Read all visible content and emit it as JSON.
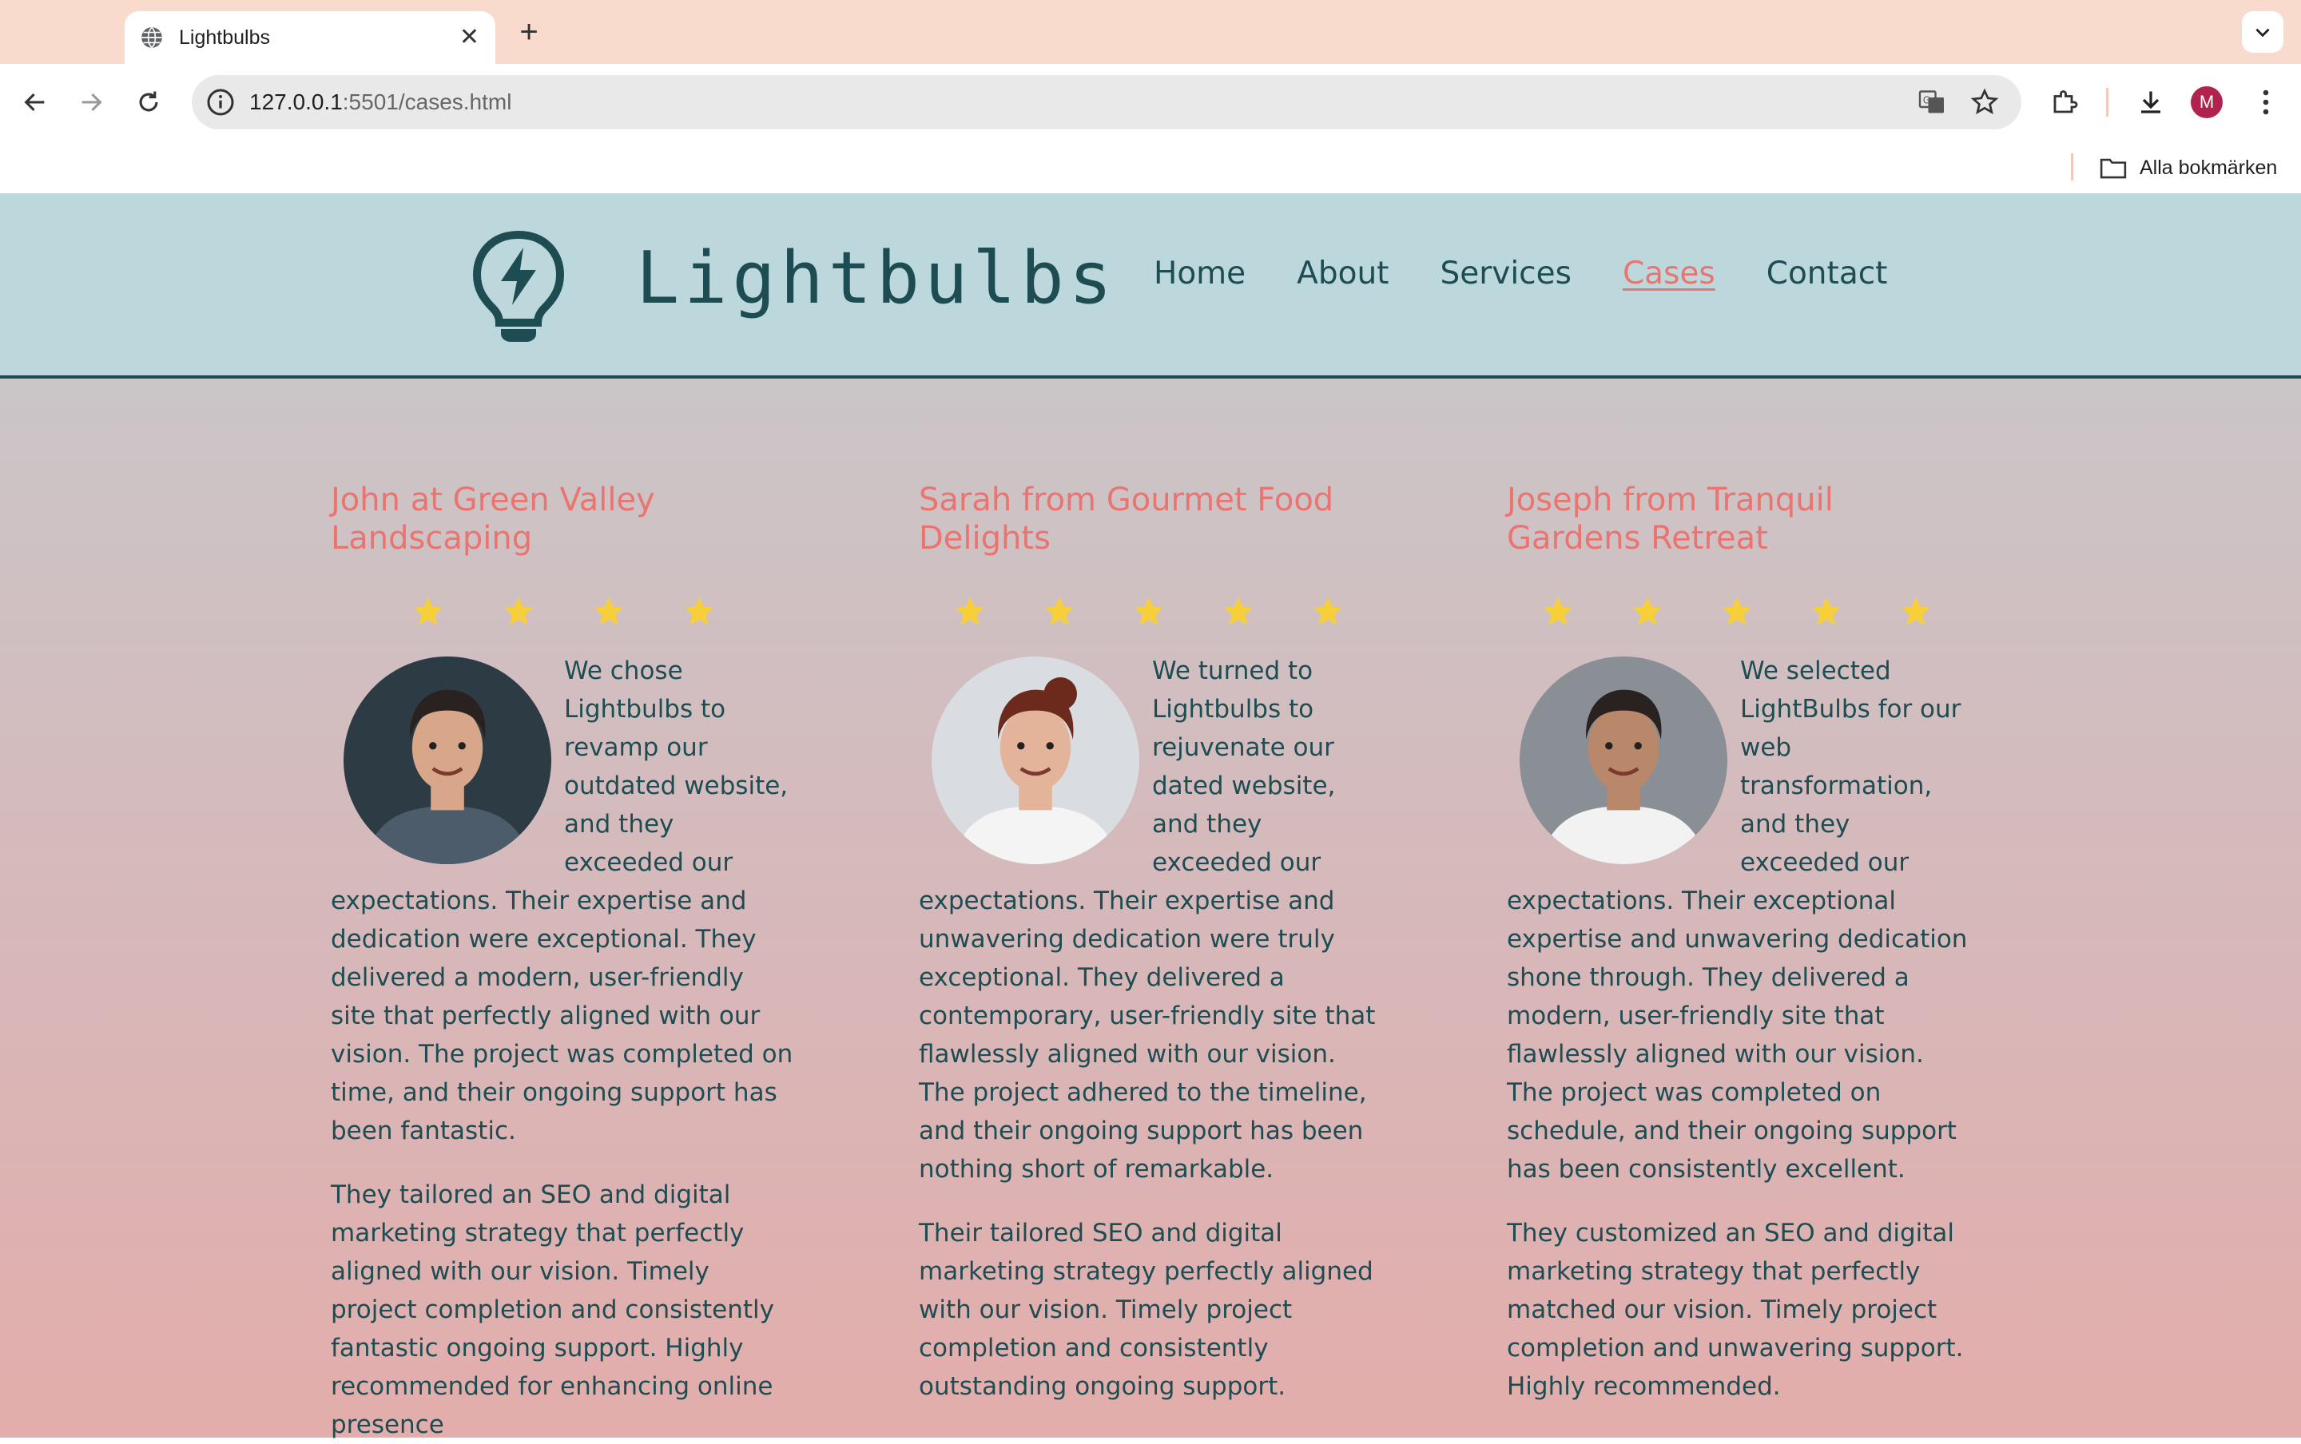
{
  "browser": {
    "tab_title": "Lightbulbs",
    "url_host": "127.0.0.1",
    "url_path": ":5501/cases.html",
    "profile_initial": "M",
    "bookmarks_all_label": "Alla bokmärken"
  },
  "site": {
    "brand": "Lightbulbs",
    "nav": [
      {
        "label": "Home"
      },
      {
        "label": "About"
      },
      {
        "label": "Services"
      },
      {
        "label": "Cases",
        "active": true
      },
      {
        "label": "Contact"
      }
    ]
  },
  "colors": {
    "header_bg": "#bcd8dc",
    "brand_dark": "#1d4d52",
    "accent": "#ea7470",
    "star": "#f6cf3a"
  },
  "cases": [
    {
      "title": "John at Green Valley Landscaping",
      "rating": 4,
      "paragraph1": "We chose Lightbulbs to revamp our outdated website, and they exceeded our expectations. Their expertise and dedication were exceptional. They delivered a modern, user-friendly site that perfectly aligned with our vision. The project was completed on time, and their ongoing support has been fantastic.",
      "paragraph2": "They tailored an SEO and digital marketing strategy that perfectly aligned with our vision. Timely project completion and consistently fantastic ongoing support. Highly recommended for enhancing online presence"
    },
    {
      "title": "Sarah from Gourmet Food Delights",
      "rating": 5,
      "paragraph1": "We turned to Lightbulbs to rejuvenate our dated website, and they exceeded our expectations. Their expertise and unwavering dedication were truly exceptional. They delivered a contemporary, user-friendly site that flawlessly aligned with our vision. The project adhered to the timeline, and their ongoing support has been nothing short of remarkable.",
      "paragraph2": "Their tailored SEO and digital marketing strategy perfectly aligned with our vision. Timely project completion and consistently outstanding ongoing support."
    },
    {
      "title": "Joseph from Tranquil Gardens Retreat",
      "rating": 5,
      "paragraph1": "We selected LightBulbs for our web transformation, and they exceeded our expectations. Their exceptional expertise and unwavering dedication shone through. They delivered a modern, user-friendly site that flawlessly aligned with our vision. The project was completed on schedule, and their ongoing support has been consistently excellent.",
      "paragraph2": "They customized an SEO and digital marketing strategy that perfectly matched our vision. Timely project completion and unwavering support. Highly recommended."
    }
  ]
}
